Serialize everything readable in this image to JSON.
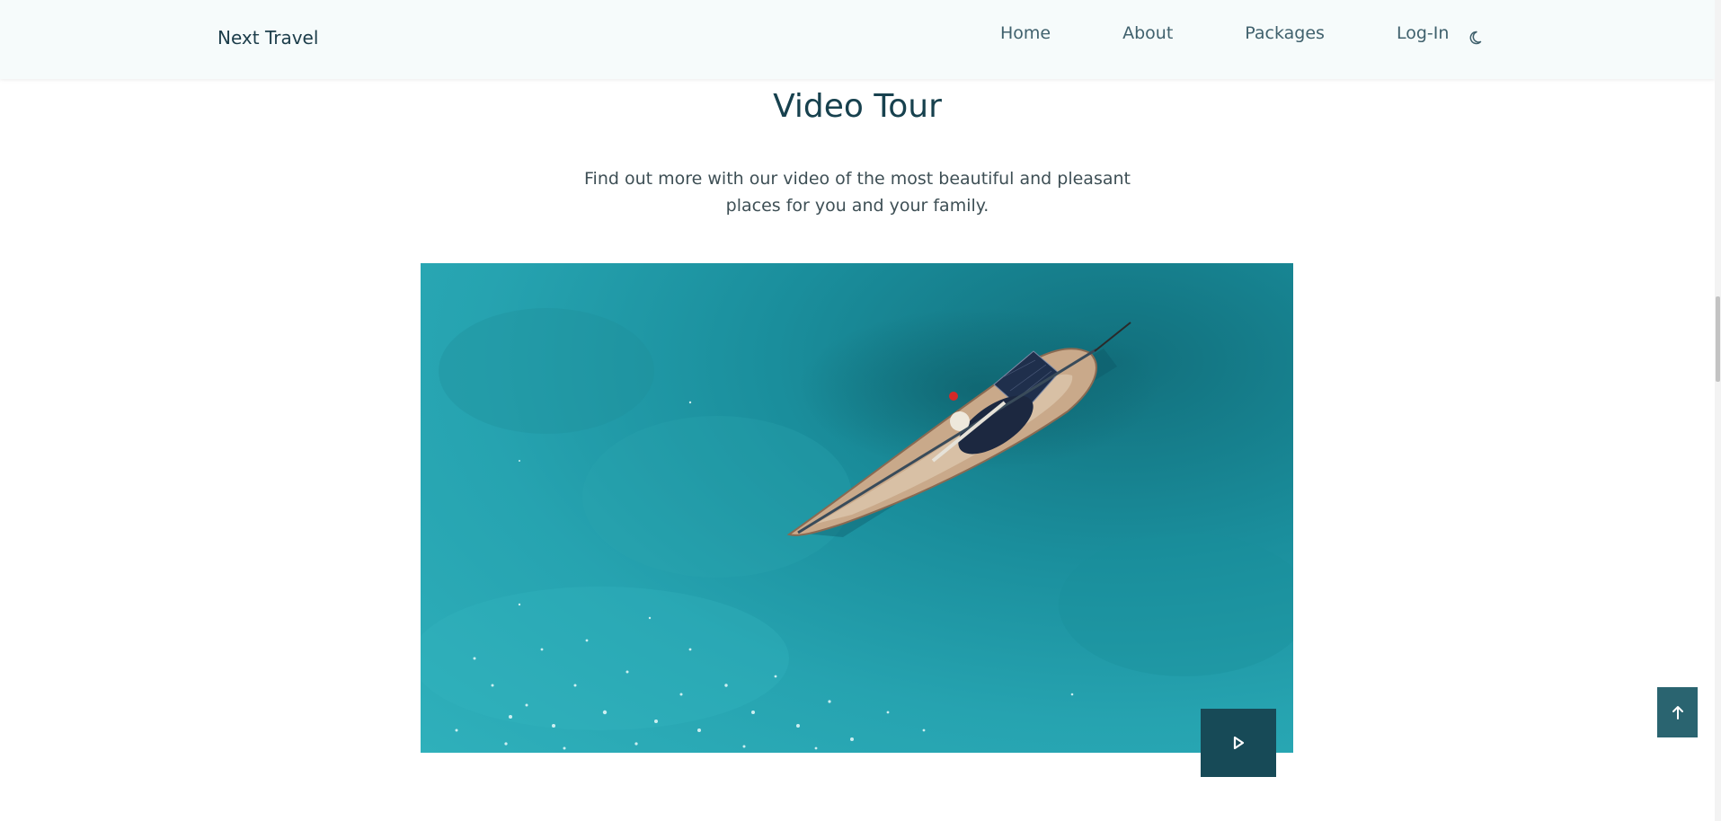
{
  "header": {
    "logo": "Next Travel",
    "nav": {
      "home": "Home",
      "about": "About",
      "packages": "Packages",
      "login": "Log-In"
    },
    "theme_toggle_icon": "moon-icon"
  },
  "section": {
    "title": "Video Tour",
    "description": "Find out more with our video of the most beautiful and pleasant places for you and your family."
  },
  "video": {
    "play_icon": "play-icon"
  },
  "scroll_top_icon": "arrow-up-icon",
  "colors": {
    "accent": "#174a57",
    "header_bg": "#f6fbfb",
    "scroll_button": "#2a6470"
  }
}
